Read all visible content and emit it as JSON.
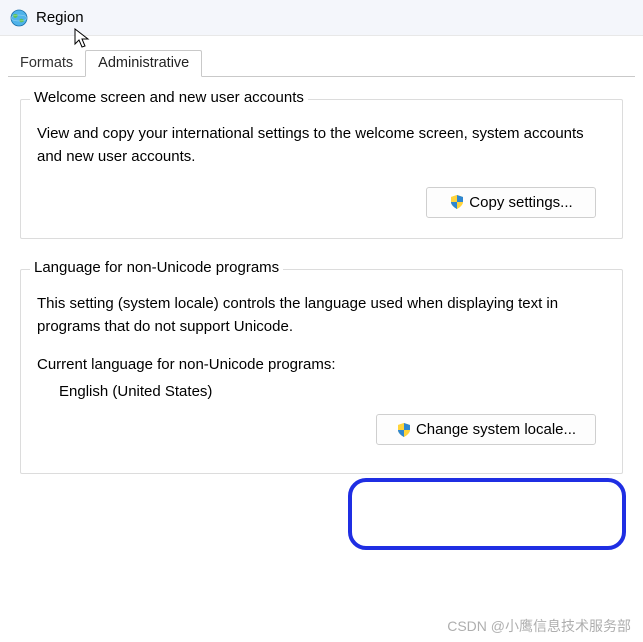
{
  "titlebar": {
    "title": "Region"
  },
  "tabs": {
    "formats": "Formats",
    "administrative": "Administrative",
    "active": "administrative"
  },
  "group_welcome": {
    "legend": "Welcome screen and new user accounts",
    "desc": "View and copy your international settings to the welcome screen, system accounts and new user accounts.",
    "button": "Copy settings..."
  },
  "group_locale": {
    "legend": "Language for non-Unicode programs",
    "desc": "This setting (system locale) controls the language used when displaying text in programs that do not support Unicode.",
    "current_label": "Current language for non-Unicode programs:",
    "current_value": "English (United States)",
    "button": "Change system locale..."
  },
  "watermark": "CSDN @小鹰信息技术服务部"
}
